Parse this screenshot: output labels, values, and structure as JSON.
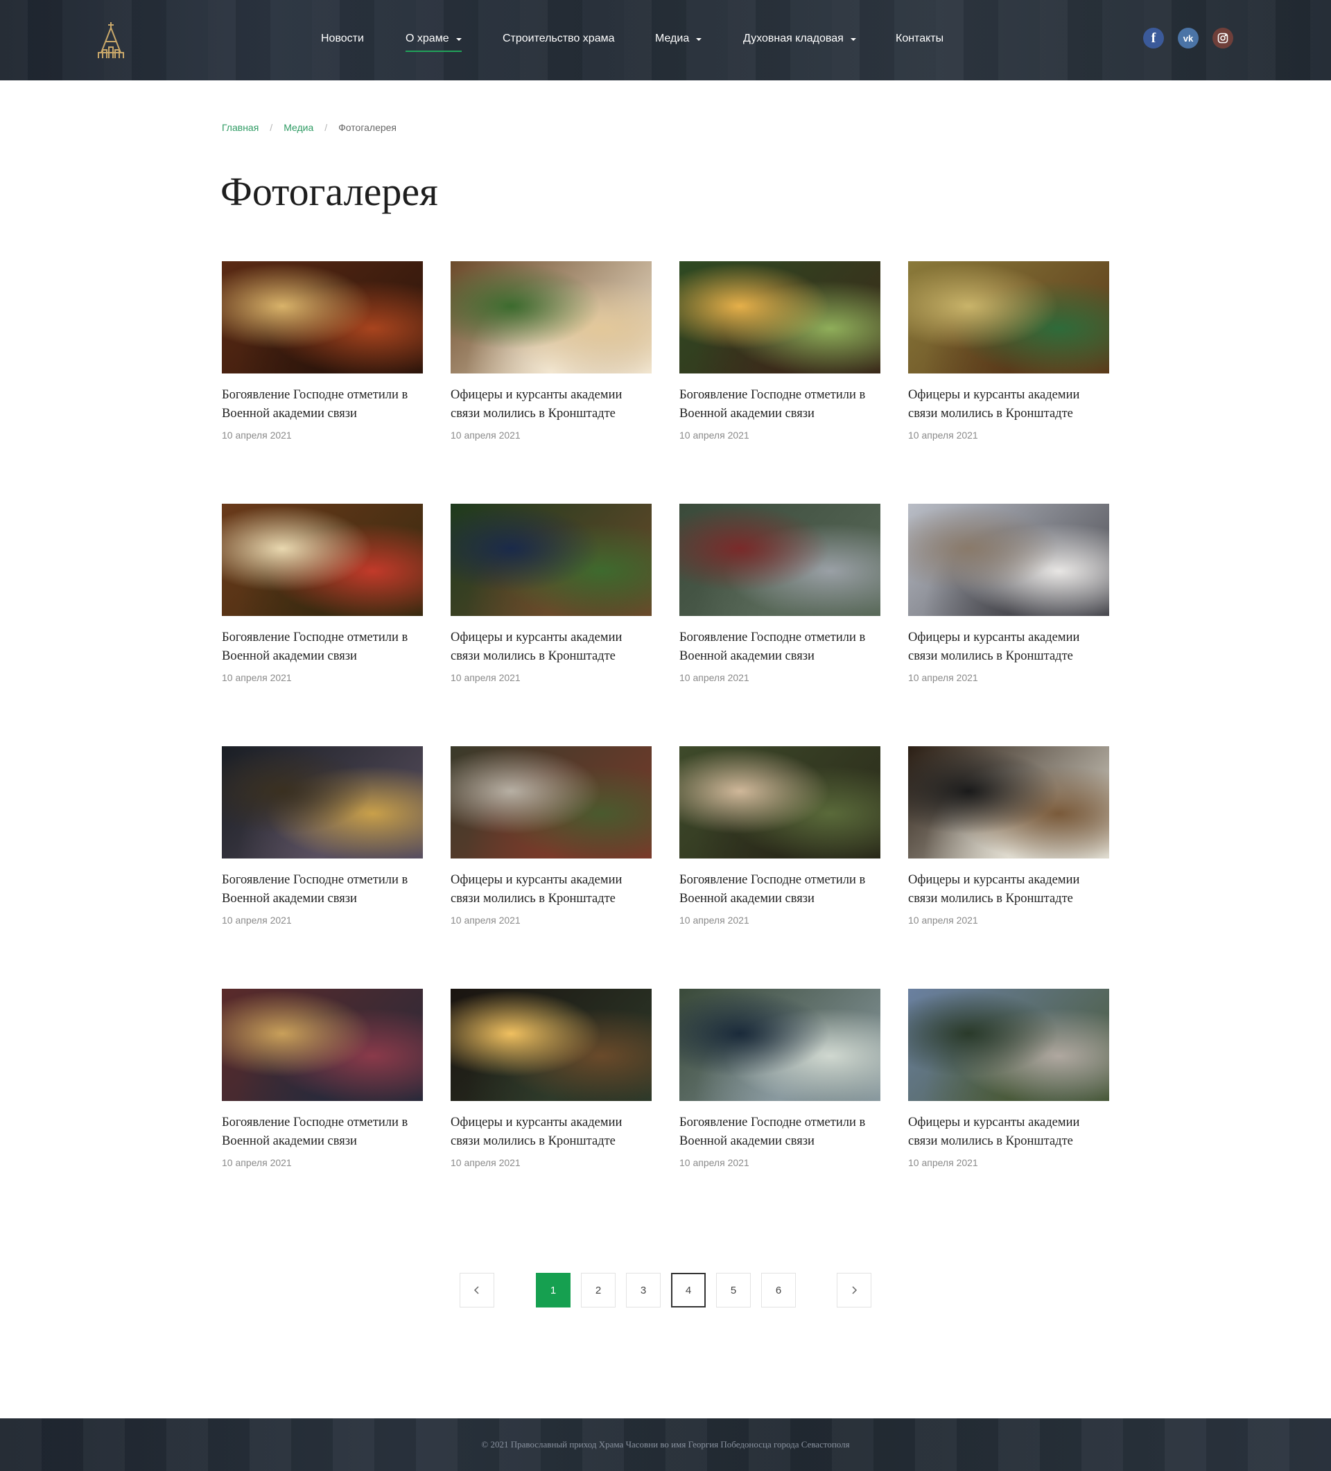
{
  "nav": {
    "items": [
      {
        "label": "Новости"
      },
      {
        "label": "О храме"
      },
      {
        "label": "Строительство храма"
      },
      {
        "label": "Медиа"
      },
      {
        "label": "Духовная кладовая"
      },
      {
        "label": "Контакты"
      }
    ],
    "socials": {
      "facebook": "f",
      "vk": "vk"
    }
  },
  "breadcrumb": {
    "home": "Главная",
    "media": "Медиа",
    "current": "Фотогалерея",
    "separator": "/"
  },
  "page": {
    "title": "Фотогалерея"
  },
  "gallery": {
    "items": [
      {
        "title": "Богоявление Господне отметили в Военной академии связи",
        "date": "10 апреля 2021",
        "photo": "patriarch-in-red-vestments"
      },
      {
        "title": "Офицеры и курсанты академии связи молились в Кронштадте",
        "date": "10 апреля 2021",
        "photo": "church-interior-with-flowers"
      },
      {
        "title": "Богоявление Господне отметили в Военной академии связи",
        "date": "10 апреля 2021",
        "photo": "altar-with-candles-and-greenery"
      },
      {
        "title": "Офицеры и курсанты академии связи молились в Кронштадте",
        "date": "10 апреля 2021",
        "photo": "beaded-icon-of-saint"
      },
      {
        "title": "Богоявление Господне отметили в Военной академии связи",
        "date": "10 апреля 2021",
        "photo": "iconostasis-with-flowers"
      },
      {
        "title": "Офицеры и курсанты академии связи молились в Кронштадте",
        "date": "10 апреля 2021",
        "photo": "christmas-nativity-scene"
      },
      {
        "title": "Богоявление Господне отметили в Военной академии связи",
        "date": "10 апреля 2021",
        "photo": "church-bells-on-carpet"
      },
      {
        "title": "Офицеры и курсанты академии связи молились в Кронштадте",
        "date": "10 апреля 2021",
        "photo": "white-chapel-with-trees"
      },
      {
        "title": "Богоявление Господне отметили в Военной академии связи",
        "date": "10 апреля 2021",
        "photo": "cathedral-interior-chandelier"
      },
      {
        "title": "Офицеры и курсанты академии связи молились в Кронштадте",
        "date": "10 апреля 2021",
        "photo": "officers-meeting-patriarch"
      },
      {
        "title": "Богоявление Господне отметили в Военной академии связи",
        "date": "10 апреля 2021",
        "photo": "cadets-in-green-uniform"
      },
      {
        "title": "Офицеры и курсанты академии связи молились в Кронштадте",
        "date": "10 апреля 2021",
        "photo": "priest-at-conference-table"
      },
      {
        "title": "Богоявление Господне отметили в Военной академии связи",
        "date": "10 апреля 2021",
        "photo": "clergy-and-officers-with-icon"
      },
      {
        "title": "Офицеры и курсанты академии связи молились в Кронштадте",
        "date": "10 апреля 2021",
        "photo": "cadets-lighting-candles"
      },
      {
        "title": "Богоявление Господне отметили в Военной академии связи",
        "date": "10 апреля 2021",
        "photo": "cadets-marching-girl-on-shoulders"
      },
      {
        "title": "Офицеры и курсанты академии связи молились в Кронштадте",
        "date": "10 апреля 2021",
        "photo": "military-parade-on-square"
      }
    ]
  },
  "pagination": {
    "pages": [
      "1",
      "2",
      "3",
      "4",
      "5",
      "6"
    ],
    "current": 1
  },
  "footer": {
    "copyright": "© 2021 Православный приход Храма Часовни во имя Георгия Победоносца города Севастополя"
  },
  "colors": {
    "accent": "#16a050",
    "link": "#2e9b63",
    "header_bg": "#252d37"
  }
}
